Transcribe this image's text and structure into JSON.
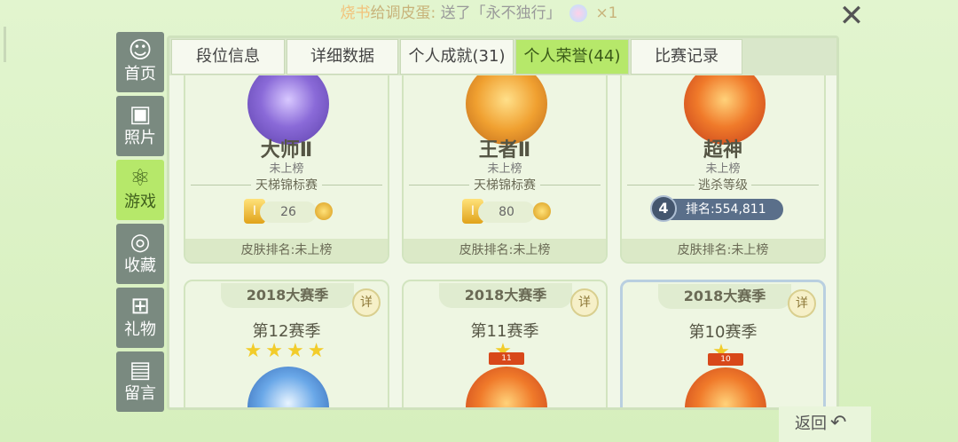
{
  "ticker": {
    "part1": "烧书",
    "part2": "给调皮蛋:",
    "part3": "送了「永不独行」",
    "count": "×1"
  },
  "sidebar": {
    "items": [
      {
        "label": "首页",
        "icon": "home-icon",
        "glyph": "☺"
      },
      {
        "label": "照片",
        "icon": "photo-icon",
        "glyph": "▣"
      },
      {
        "label": "游戏",
        "icon": "atom-icon",
        "glyph": "⚛"
      },
      {
        "label": "收藏",
        "icon": "collection-icon",
        "glyph": "◎"
      },
      {
        "label": "礼物",
        "icon": "gift-icon",
        "glyph": "⊞"
      },
      {
        "label": "留言",
        "icon": "message-icon",
        "glyph": "▤"
      }
    ]
  },
  "tabs": [
    {
      "label": "段位信息"
    },
    {
      "label": "详细数据"
    },
    {
      "label": "个人成就(31)"
    },
    {
      "label": "个人荣誉(44)"
    },
    {
      "label": "比赛记录"
    }
  ],
  "active_tab": "个人荣誉(44)",
  "honors": [
    {
      "title": "大师Ⅱ",
      "sub": "未上榜",
      "event": "天梯锦标赛",
      "score": "26",
      "skin_rank": "皮肤排名:未上榜"
    },
    {
      "title": "王者Ⅱ",
      "sub": "未上榜",
      "event": "天梯锦标赛",
      "score": "80",
      "skin_rank": "皮肤排名:未上榜"
    },
    {
      "title": "超神",
      "sub": "未上榜",
      "event": "逃杀等级",
      "rank_num": "4",
      "rank_label": "排名:554,811",
      "skin_rank": "皮肤排名:未上榜"
    }
  ],
  "seasons": [
    {
      "year": "2018大赛季",
      "name": "第12赛季",
      "detail": "详",
      "stars": "★★★★"
    },
    {
      "year": "2018大赛季",
      "name": "第11赛季",
      "detail": "详",
      "stars": "★",
      "ribbon": "11"
    },
    {
      "year": "2018大赛季",
      "name": "第10赛季",
      "detail": "详",
      "stars": "★",
      "ribbon": "10"
    }
  ],
  "back": {
    "label": "返回"
  },
  "close": {
    "glyph": "✕"
  }
}
